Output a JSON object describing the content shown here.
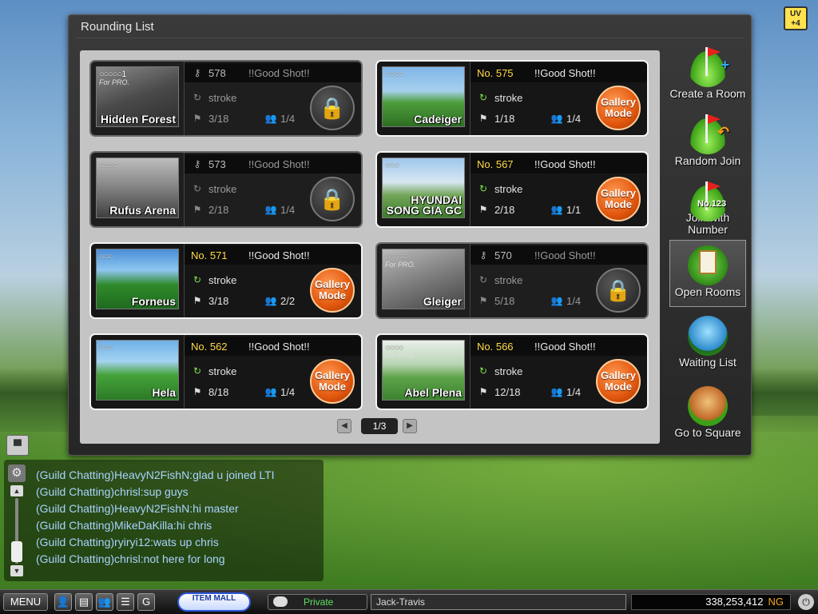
{
  "panel": {
    "title": "Rounding List"
  },
  "rooms": [
    {
      "no": "578",
      "name": "!!Good Shot!!",
      "mode": "stroke",
      "holes": "3/18",
      "players": "1/4",
      "course": "Hidden Forest",
      "rings": "○○○○○1",
      "for_pro": "For PRO.",
      "locked": true
    },
    {
      "no": "No. 575",
      "name": "!!Good Shot!!",
      "mode": "stroke",
      "holes": "1/18",
      "players": "1/4",
      "course": "Cadeiger",
      "rings": "○○○○",
      "action": "Gallery Mode",
      "locked": false
    },
    {
      "no": "573",
      "name": "!!Good Shot!!",
      "mode": "stroke",
      "holes": "2/18",
      "players": "1/4",
      "course": "Rufus Arena",
      "rings": "○○○○",
      "locked": true
    },
    {
      "no": "No. 567",
      "name": "!!Good Shot!!",
      "mode": "stroke",
      "holes": "2/18",
      "players": "1/1",
      "course": "HYUNDAI SONG GIA GC",
      "rings": "○○○",
      "action": "Gallery Mode",
      "locked": false
    },
    {
      "no": "No. 571",
      "name": "!!Good Shot!!",
      "mode": "stroke",
      "holes": "3/18",
      "players": "2/2",
      "course": "Forneus",
      "rings": "○○○",
      "action": "Gallery Mode",
      "locked": false
    },
    {
      "no": "570",
      "name": "!!Good Shot!!",
      "mode": "stroke",
      "holes": "5/18",
      "players": "1/4",
      "course": "Gleiger",
      "rings": "○○○○○",
      "for_pro": "For PRO.",
      "locked": true
    },
    {
      "no": "No. 562",
      "name": "!!Good Shot!!",
      "mode": "stroke",
      "holes": "8/18",
      "players": "1/4",
      "course": "Hela",
      "rings": "○○○",
      "action": "Gallery Mode",
      "locked": false
    },
    {
      "no": "No. 566",
      "name": "!!Good Shot!!",
      "mode": "stroke",
      "holes": "12/18",
      "players": "1/4",
      "course": "Abel Plena",
      "rings": "○○○○",
      "for_pro": "For PRO.",
      "action": "Gallery Mode",
      "locked": false
    }
  ],
  "pager": {
    "page": "1/3"
  },
  "side": {
    "create": "Create a Room",
    "random": "Random Join",
    "join_number_badge": "No.123",
    "join_number": "Join with Number",
    "open_rooms": "Open Rooms",
    "waiting": "Waiting List",
    "square": "Go to Square"
  },
  "chat": {
    "lines": [
      "(Guild Chatting)HeavyN2FishN:glad u joined LTI",
      "(Guild Chatting)chrisl:sup guys",
      "(Guild Chatting)HeavyN2FishN:hi master",
      "(Guild Chatting)MikeDaKilla:hi chris",
      "(Guild Chatting)ryiryi12:wats up chris",
      "(Guild Chatting)chrisl:not here for long"
    ]
  },
  "bottom": {
    "menu": "MENU",
    "g": "G",
    "item_mall": "ITEM MALL",
    "chat_mode": "Private",
    "chat_input": "Jack-Travis",
    "ng_amount": "338,253,412",
    "ng_unit": "NG"
  },
  "topright": {
    "label": "UV +4"
  },
  "colors": {
    "gold": "#ffd94a",
    "gallery": "#e2570e",
    "chat_text": "#a9d3ff",
    "ng": "#f5a623"
  }
}
